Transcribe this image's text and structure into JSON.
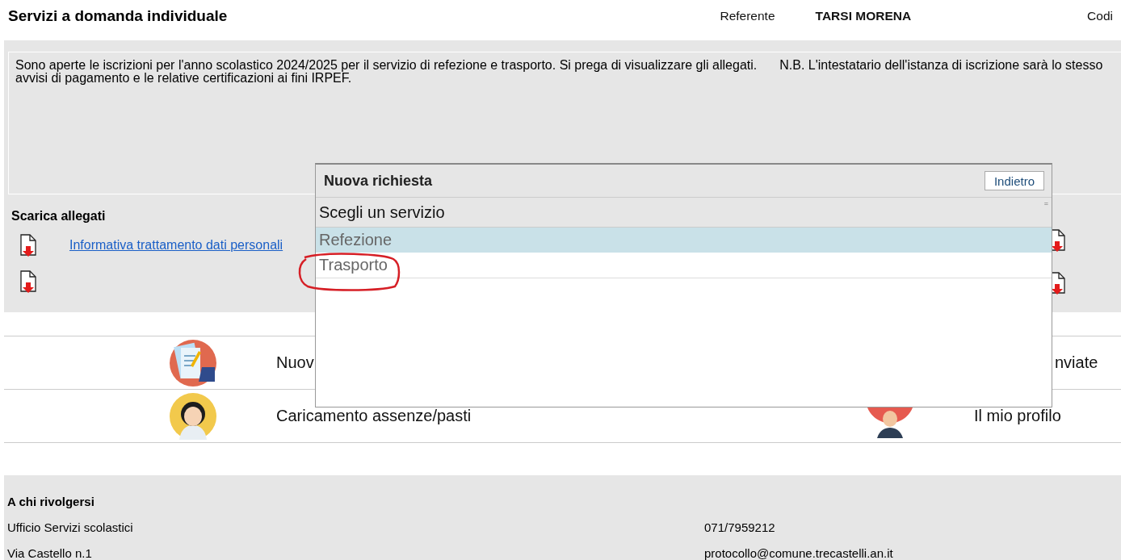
{
  "header": {
    "title": "Servizi a domanda individuale",
    "referent_label": "Referente",
    "referent_name": "TARSI MORENA",
    "cut_label": "Codi"
  },
  "notice": {
    "first": "Sono aperte le iscrizioni per l'anno scolastico 2024/2025 per il servizio di refezione e trasporto. Si prega di visualizzare gli allegati.",
    "second": "N.B. L'intestatario dell'istanza di iscrizione sarà lo stesso",
    "third": "avvisi di pagamento e le relative certificazioni ai fini IRPEF."
  },
  "downloads": {
    "title": "Scarica allegati",
    "links": [
      "Informativa trattamento dati personali"
    ]
  },
  "menu": [
    {
      "left": "Nuov",
      "right": "nviate"
    },
    {
      "left": "Caricamento assenze/pasti",
      "right": "Il mio profilo"
    }
  ],
  "contacts": {
    "title": "A chi rivolgersi",
    "rows": [
      {
        "left": "Ufficio Servizi scolastici",
        "right": "071/7959212"
      },
      {
        "left": "Via Castello n.1",
        "right": "protocollo@comune.trecastelli.an.it"
      }
    ]
  },
  "dialog": {
    "title": "Nuova richiesta",
    "back_button": "Indietro",
    "select_label": "Scegli un servizio",
    "handle": "=",
    "options": [
      {
        "label": "Refezione",
        "selected": true
      },
      {
        "label": "Trasporto",
        "selected": false
      }
    ]
  }
}
